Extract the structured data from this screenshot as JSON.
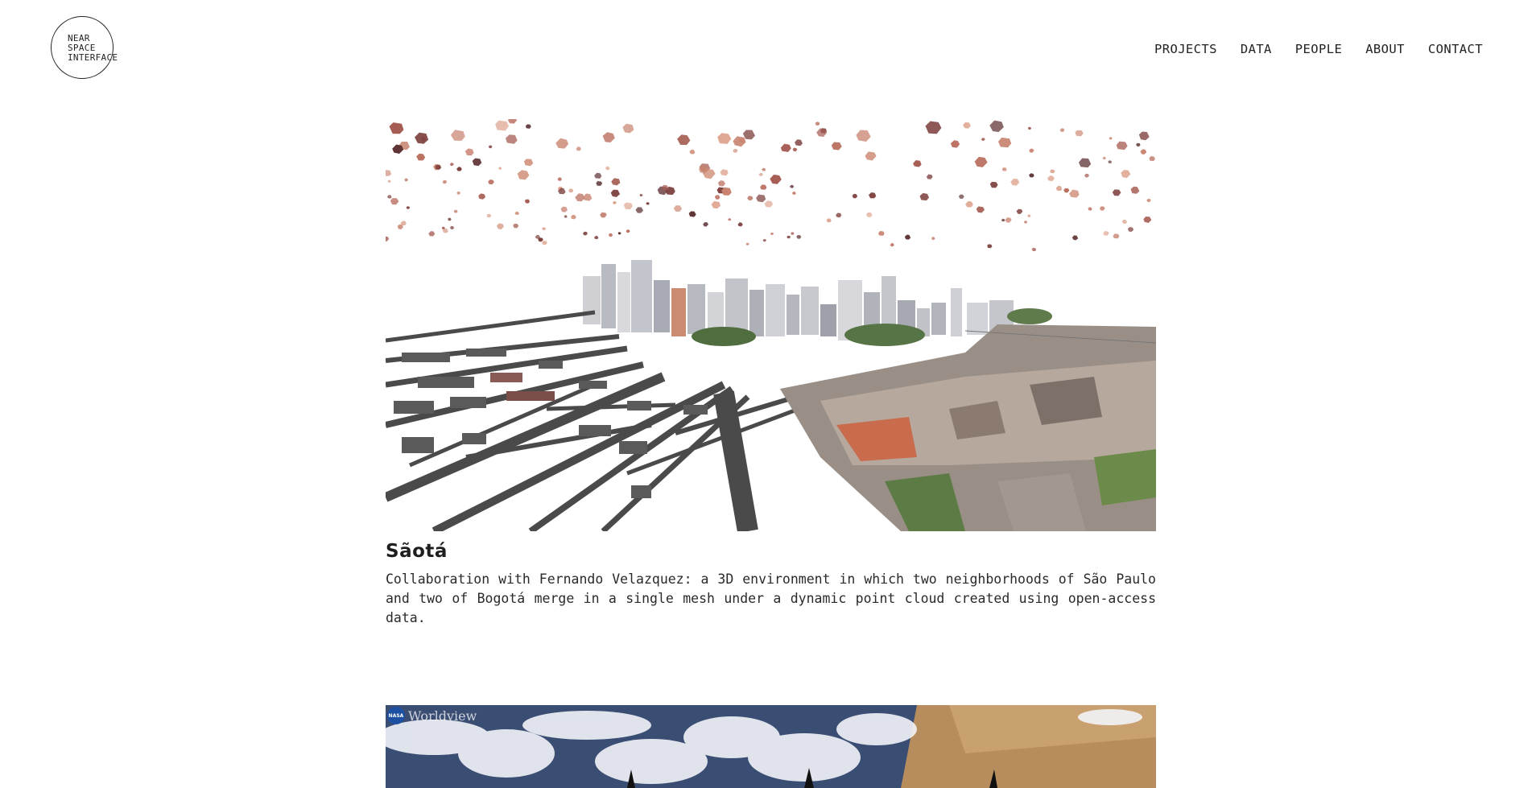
{
  "header": {
    "logo_text": "NEAR\nSPACE\nINTERFACE",
    "nav": [
      "PROJECTS",
      "DATA",
      "PEOPLE",
      "ABOUT",
      "CONTACT"
    ]
  },
  "projects": [
    {
      "title": "Sãotá",
      "description": "Collaboration with Fernando Velazquez: a 3D environment in which two neighborhoods of São Paulo and two of Bogotá merge in a single mesh under a dynamic point cloud created using open-access data.",
      "image": "3d-city-point-cloud"
    },
    {
      "image": "satellite-worldview",
      "watermark": "Worldview",
      "badge": "NASA"
    }
  ],
  "colors": {
    "text": "#222222",
    "background": "#ffffff",
    "roads": "#4a4a4a",
    "points": "#c8826e"
  }
}
